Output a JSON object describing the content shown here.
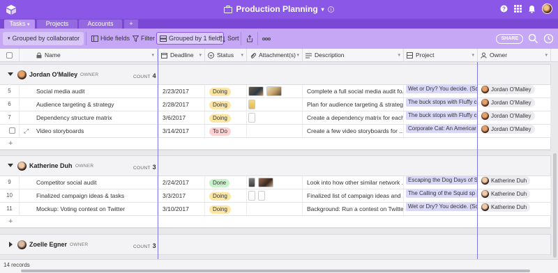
{
  "app": {
    "title": "Production Planning"
  },
  "tabs": [
    {
      "label": "Tasks"
    },
    {
      "label": "Projects"
    },
    {
      "label": "Accounts"
    },
    {
      "label": "+"
    }
  ],
  "toolbar": {
    "grouped_by_collaborator": "Grouped by collaborator",
    "hide_fields": "Hide fields",
    "filter": "Filter",
    "grouped_by_field": "Grouped by 1 field",
    "sort": "Sort",
    "share": "SHARE"
  },
  "columns": {
    "name": "Name",
    "deadline": "Deadline",
    "status": "Status",
    "attachments": "Attachment(s)",
    "description": "Description",
    "project": "Project",
    "owner": "Owner"
  },
  "groups": [
    {
      "name": "Jordan O'Malley",
      "role": "OWNER",
      "count_label": "COUNT",
      "count": "4",
      "rows": [
        {
          "num": "5",
          "name": "Social media audit",
          "deadline": "2/23/2017",
          "status": "Doing",
          "description": "Complete a full social media audit fo...",
          "project": "Wet or Dry? You decide. (Sc",
          "owner": "Jordan O'Malley"
        },
        {
          "num": "6",
          "name": "Audience targeting & strategy",
          "deadline": "2/28/2017",
          "status": "Doing",
          "description": "Plan for audience targeting & strateg...",
          "project": "The buck stops with Fluffy c",
          "owner": "Jordan O'Malley"
        },
        {
          "num": "7",
          "name": "Dependency structure matrix",
          "deadline": "3/6/2017",
          "status": "Doing",
          "description": "Create a dependency matrix for each...",
          "project": "The buck stops with Fluffy c",
          "owner": "Jordan O'Malley"
        },
        {
          "num": "",
          "name": "Video storyboards",
          "deadline": "3/14/2017",
          "status": "To Do",
          "description": "Create a few video storyboards for ...",
          "project": "Corporate Cat: An Americar",
          "owner": "Jordan O'Malley"
        }
      ]
    },
    {
      "name": "Katherine Duh",
      "role": "OWNER",
      "count_label": "COUNT",
      "count": "3",
      "rows": [
        {
          "num": "9",
          "name": "Competitor social audit",
          "deadline": "2/24/2017",
          "status": "Done",
          "description": "Look into how other similar network ...",
          "project": "Escaping the Dog Days of S",
          "owner": "Katherine Duh"
        },
        {
          "num": "10",
          "name": "Finalized campaign ideas & tasks",
          "deadline": "3/3/2017",
          "status": "Doing",
          "description": "Finalized list of campaign ideas and ...",
          "project": "The Calling of the Squid sp",
          "owner": "Katherine Duh"
        },
        {
          "num": "11",
          "name": "Mockup: Voting contest on Twitter",
          "deadline": "3/10/2017",
          "status": "Doing",
          "description": "Background: Run a contest on Twitte...",
          "project": "Wet or Dry? You decide. (Sc",
          "owner": "Katherine Duh"
        }
      ]
    },
    {
      "name": "Zoelle Egner",
      "role": "OWNER",
      "count_label": "COUNT",
      "count": "3"
    }
  ],
  "footer": {
    "records": "14 records"
  },
  "colors": {
    "topbar": "#8b57e7",
    "toolbar": "#c5a7f6",
    "doing": "#fce6a6",
    "todo": "#fcd1d1",
    "done": "#c8f1c9",
    "project_tag": "#d9d8f8"
  }
}
